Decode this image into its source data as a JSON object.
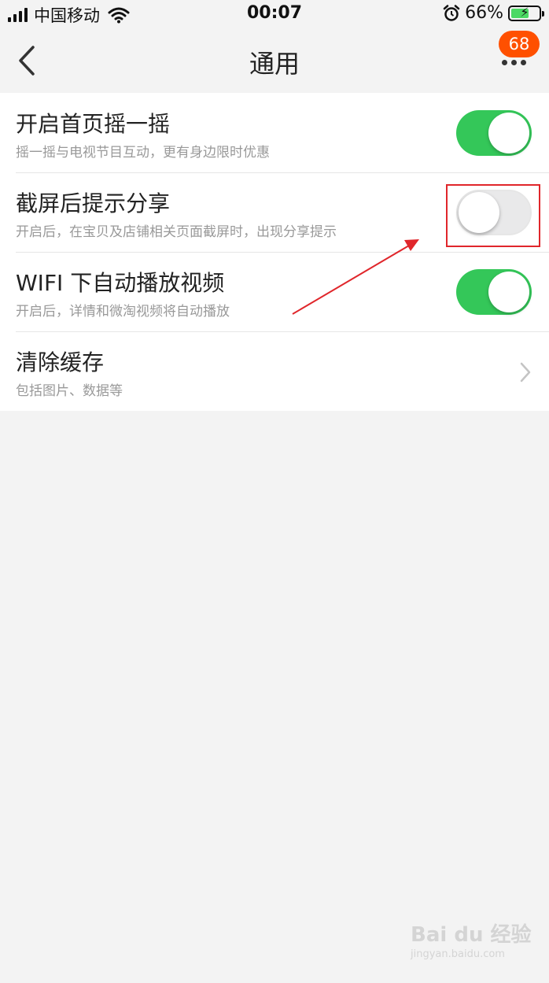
{
  "status_bar": {
    "carrier": "中国移动",
    "time": "00:07",
    "battery_percent": "66%",
    "battery_level": 0.66,
    "icons": [
      "signal-icon",
      "wifi-icon",
      "alarm-icon",
      "battery-charging-icon"
    ]
  },
  "nav": {
    "title": "通用",
    "back_icon": "chevron-left-icon",
    "more_icon": "more-dots-icon",
    "badge_count": "68"
  },
  "settings": [
    {
      "title": "开启首页摇一摇",
      "subtitle": "摇一摇与电视节目互动，更有身边限时优惠",
      "control": "toggle",
      "on": true
    },
    {
      "title": "截屏后提示分享",
      "subtitle": "开启后，在宝贝及店铺相关页面截屏时，出现分享提示",
      "control": "toggle",
      "on": false
    },
    {
      "title": "WIFI 下自动播放视频",
      "subtitle": "开启后，详情和微淘视频将自动播放",
      "control": "toggle",
      "on": true
    },
    {
      "title": "清除缓存",
      "subtitle": "包括图片、数据等",
      "control": "chevron"
    }
  ],
  "watermark": {
    "text": "Bai du 经验",
    "url": "jingyan.baidu.com"
  },
  "colors": {
    "toggle_on": "#34c759",
    "badge": "#ff5000",
    "annotation": "#e0262b",
    "battery_fill": "#4cd964"
  }
}
